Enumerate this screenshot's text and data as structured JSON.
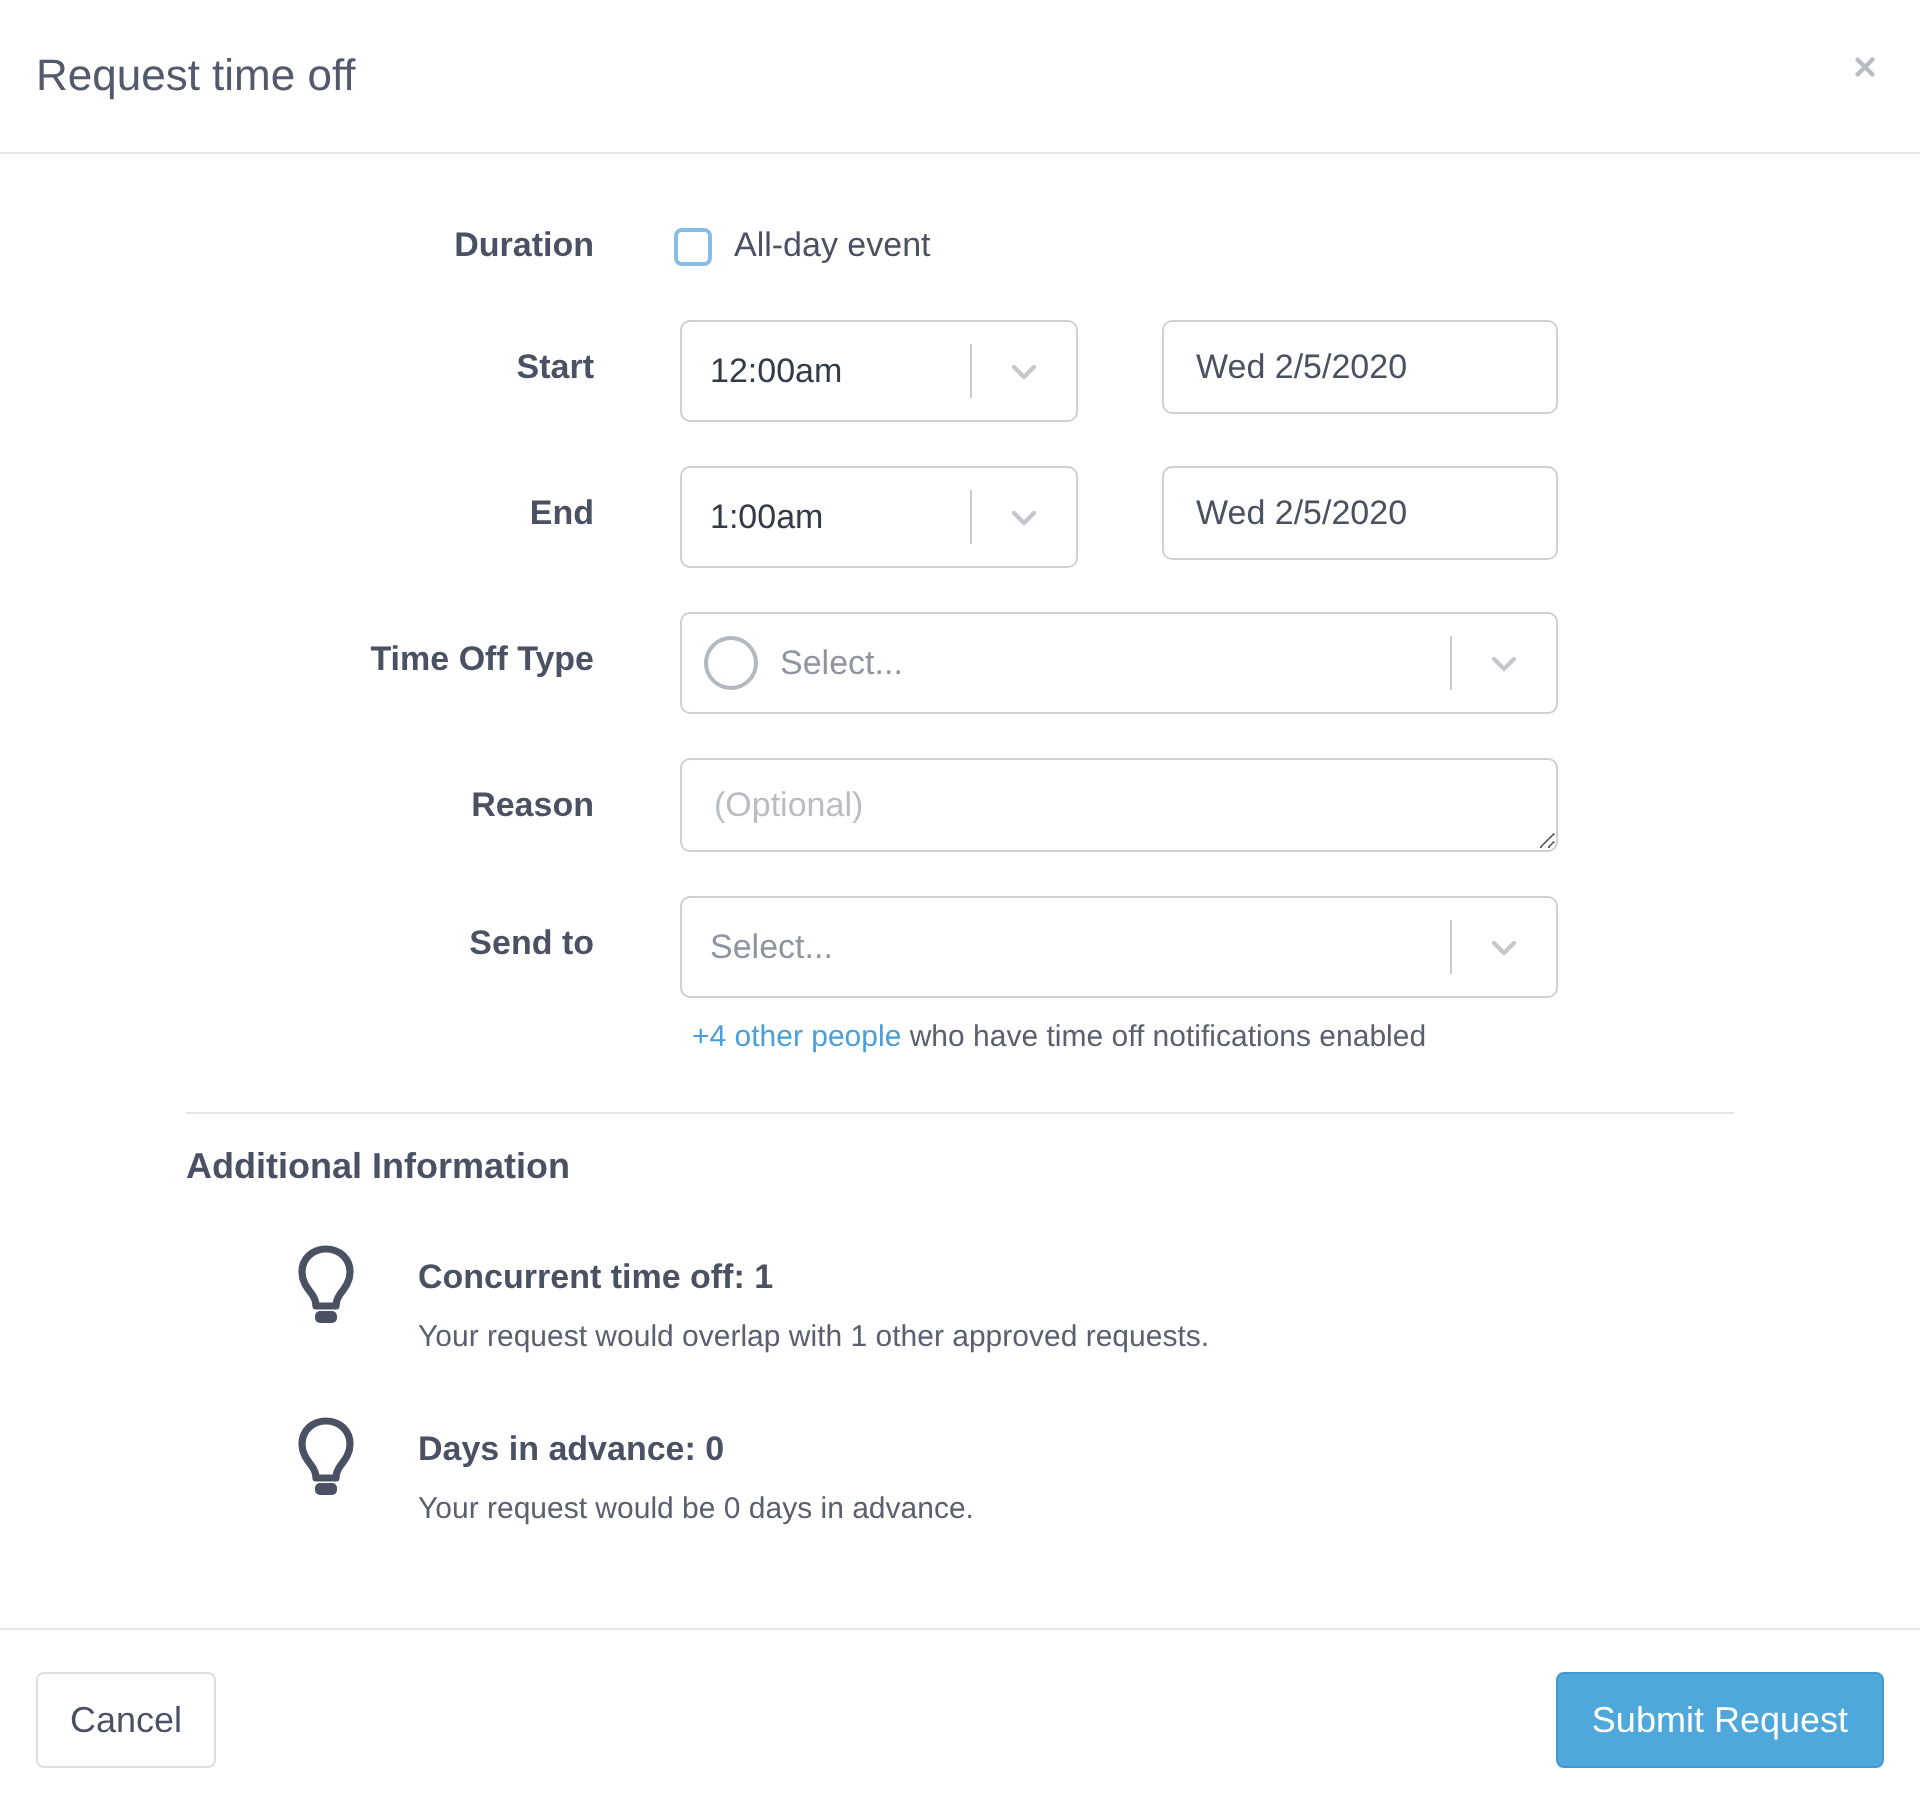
{
  "dialog": {
    "title": "Request time off"
  },
  "form": {
    "rows": [
      {
        "kind": "checkbox",
        "label": "Duration",
        "option": "All-day event",
        "checked": false
      },
      {
        "kind": "time_date",
        "label": "Start",
        "time": "12:00am",
        "date": "Wed 2/5/2020"
      },
      {
        "kind": "time_date",
        "label": "End",
        "time": "1:00am",
        "date": "Wed 2/5/2020"
      },
      {
        "kind": "swatch_select",
        "label": "Time Off Type",
        "placeholder": "Select..."
      },
      {
        "kind": "textarea",
        "label": "Reason",
        "placeholder": "(Optional)"
      },
      {
        "kind": "select",
        "label": "Send to",
        "placeholder": "Select...",
        "note": {
          "link": "+4 other people",
          "text": "who have time off notifications enabled"
        }
      }
    ]
  },
  "additional_information": {
    "title": "Additional Information",
    "items": [
      {
        "title": "Concurrent time off: 1",
        "text": "Your request would overlap with 1 other approved requests."
      },
      {
        "title": "Days in advance: 0",
        "text": "Your request would be 0 days in advance."
      }
    ]
  },
  "footer": {
    "buttons": [
      {
        "kind": "secondary",
        "label": "Cancel"
      },
      {
        "kind": "primary",
        "label": "Submit Request"
      }
    ]
  }
}
